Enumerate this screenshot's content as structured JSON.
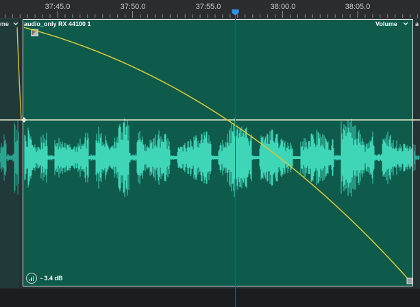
{
  "ruler": {
    "ticks": [
      {
        "label": "37:45.0"
      },
      {
        "label": "37:50.0"
      },
      {
        "label": "37:55.0"
      },
      {
        "label": "38:00.0"
      },
      {
        "label": "38:05.0"
      }
    ]
  },
  "prev_clip": {
    "label_tail": "me",
    "menu_icon": "chevron-down-icon"
  },
  "clip": {
    "title": "audio_only RX 44100 1",
    "param_label": "Volume",
    "param_menu_icon": "chevron-down-icon",
    "gain": "- 3.4 dB",
    "gain_icon": "volume-meter-icon",
    "fade_handle_icon": "fade-handle-icon"
  },
  "next_clip": {
    "label_head": "a"
  },
  "colors": {
    "clip_bg": "#0e5a4b",
    "waveform": "#3fd6b8",
    "envelope_curve": "#d4c63a",
    "volume_line": "#e6edcf",
    "playhead": "#b0263a",
    "playhead_head": "#2f8fe8"
  }
}
